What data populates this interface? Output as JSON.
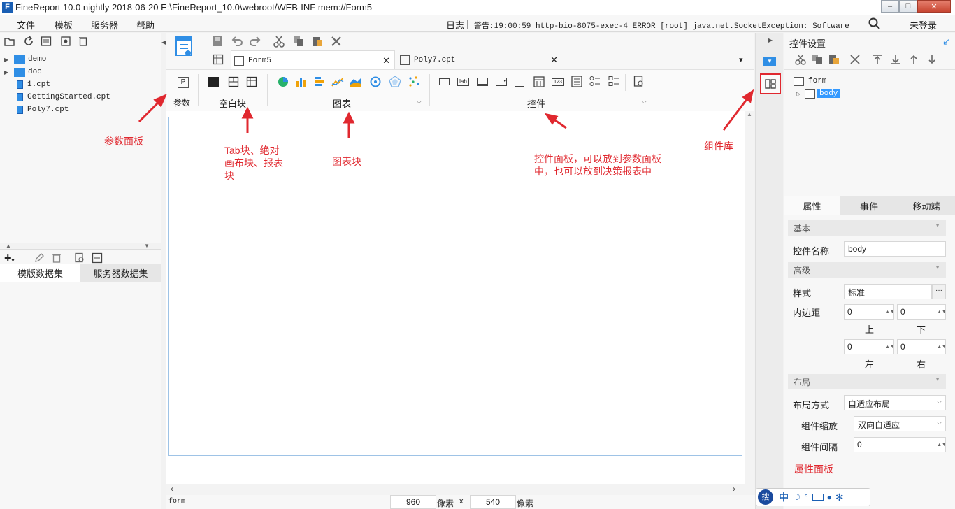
{
  "app": {
    "title": "FineReport 10.0 nightly 2018-06-20 E:\\FineReport_10.0\\webroot/WEB-INF    mem://Form5"
  },
  "window_controls": {
    "minimize": "–",
    "maximize": "□",
    "close": "✕"
  },
  "menu": {
    "items": [
      "文件",
      "模板",
      "服务器",
      "帮助"
    ],
    "log_label": "日志",
    "warning": "警告:19:00:59 http-bio-8075-exec-4 ERROR [root] java.net.SocketException: Software caused ...",
    "login": "未登录"
  },
  "file_tree": {
    "items": [
      {
        "label": "demo",
        "type": "folder"
      },
      {
        "label": "doc",
        "type": "folder"
      },
      {
        "label": "1.cpt",
        "type": "file"
      },
      {
        "label": "GettingStarted.cpt",
        "type": "file"
      },
      {
        "label": "Poly7.cpt",
        "type": "file"
      }
    ]
  },
  "dataset_tabs": [
    "模版数据集",
    "服务器数据集"
  ],
  "editor": {
    "tabs": [
      {
        "label": "Form5",
        "active": true
      },
      {
        "label": "Poly7.cpt",
        "active": false
      }
    ],
    "groups": {
      "param": "参数",
      "blank": "空白块",
      "chart": "图表",
      "widget": "控件"
    },
    "param_icon": "P",
    "widget_icon_labels": {
      "label": "lab",
      "number": "123"
    }
  },
  "annotations": {
    "param_panel": "参数面板",
    "blank": "Tab块、绝对\n画布块、报表\n块",
    "chart": "图表块",
    "widget": "控件面板，可以放到参数面板\n中，也可以放到决策报表中",
    "component_lib": "组件库",
    "property_panel": "属性面板",
    "accent": "#e0282f"
  },
  "status": {
    "form_label": "form",
    "width": "960",
    "height": "540",
    "unit": "像素",
    "x_sep": "x"
  },
  "right_panel": {
    "title": "控件设置",
    "tree": [
      {
        "label": "form"
      },
      {
        "label": "body",
        "selected": true
      }
    ],
    "tabs": [
      "属性",
      "事件",
      "移动端"
    ],
    "sections": {
      "basic": "基本",
      "advanced": "高级",
      "layout": "布局"
    },
    "widget_name_label": "控件名称",
    "widget_name": "body",
    "style_label": "样式",
    "style_value": "标准",
    "more": "···",
    "padding_label": "内边距",
    "padding_top": "0",
    "padding_bottom": "0",
    "padding_left": "0",
    "padding_right": "0",
    "top": "上",
    "bottom": "下",
    "left": "左",
    "right": "右",
    "layout_mode_label": "布局方式",
    "layout_mode": "自适应布局",
    "scale_label": "组件缩放",
    "scale": "双向自适应",
    "gap_label": "组件间隔",
    "gap": "0"
  },
  "ime": {
    "lang": "中",
    "label": "搜"
  },
  "colors": {
    "accent_blue": "#2f8ee5",
    "selection": "#3399ff",
    "red_note": "#e0282f"
  }
}
